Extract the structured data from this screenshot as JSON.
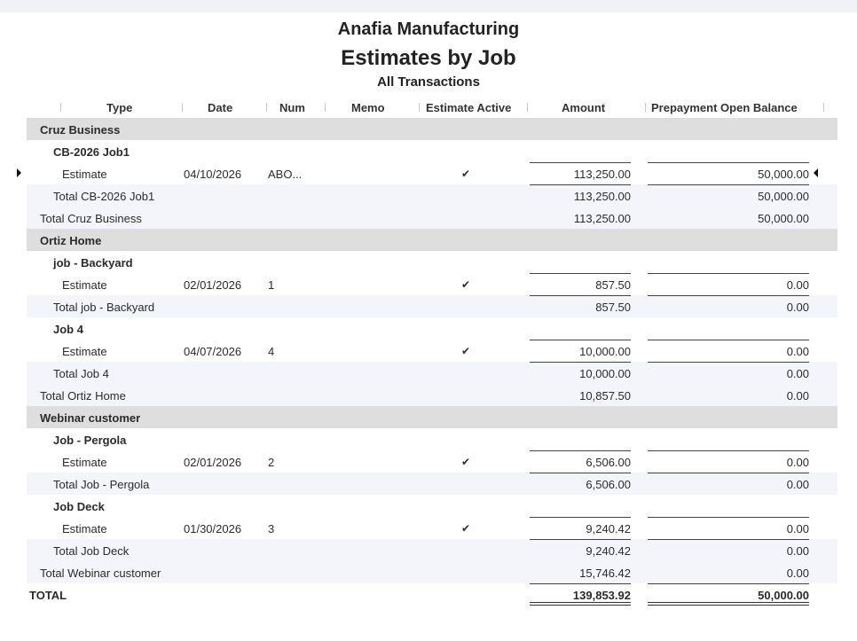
{
  "report": {
    "company": "Anafia Manufacturing",
    "name": "Estimates by Job",
    "period": "All Transactions"
  },
  "columns": {
    "type": "Type",
    "date": "Date",
    "num": "Num",
    "memo": "Memo",
    "active": "Estimate Active",
    "amount": "Amount",
    "prepay": "Prepayment Open Balance"
  },
  "rows": [
    {
      "kind": "customer",
      "label": "Cruz Business"
    },
    {
      "kind": "job",
      "label": "CB-2026 Job1"
    },
    {
      "kind": "txn",
      "label": "Estimate",
      "date": "04/10/2026",
      "num": "ABO...",
      "memo": "",
      "active": "✔",
      "amount": "113,250.00",
      "prepay": "50,000.00",
      "selected": true
    },
    {
      "kind": "jobtotal",
      "label": "Total CB-2026 Job1",
      "amount": "113,250.00",
      "prepay": "50,000.00"
    },
    {
      "kind": "custtotal",
      "label": "Total Cruz Business",
      "amount": "113,250.00",
      "prepay": "50,000.00"
    },
    {
      "kind": "customer",
      "label": "Ortiz Home"
    },
    {
      "kind": "job",
      "label": "job - Backyard"
    },
    {
      "kind": "txn",
      "label": "Estimate",
      "date": "02/01/2026",
      "num": "1",
      "memo": "",
      "active": "✔",
      "amount": "857.50",
      "prepay": "0.00"
    },
    {
      "kind": "jobtotal",
      "label": "Total job - Backyard",
      "amount": "857.50",
      "prepay": "0.00"
    },
    {
      "kind": "job",
      "label": "Job 4"
    },
    {
      "kind": "txn",
      "label": "Estimate",
      "date": "04/07/2026",
      "num": "4",
      "memo": "",
      "active": "✔",
      "amount": "10,000.00",
      "prepay": "0.00"
    },
    {
      "kind": "jobtotal",
      "label": "Total Job 4",
      "amount": "10,000.00",
      "prepay": "0.00"
    },
    {
      "kind": "custtotal",
      "label": "Total Ortiz Home",
      "amount": "10,857.50",
      "prepay": "0.00"
    },
    {
      "kind": "customer",
      "label": "Webinar customer"
    },
    {
      "kind": "job",
      "label": "Job - Pergola"
    },
    {
      "kind": "txn",
      "label": "Estimate",
      "date": "02/01/2026",
      "num": "2",
      "memo": "",
      "active": "✔",
      "amount": "6,506.00",
      "prepay": "0.00"
    },
    {
      "kind": "jobtotal",
      "label": "Total Job - Pergola",
      "amount": "6,506.00",
      "prepay": "0.00"
    },
    {
      "kind": "job",
      "label": "Job Deck"
    },
    {
      "kind": "txn",
      "label": "Estimate",
      "date": "01/30/2026",
      "num": "3",
      "memo": "",
      "active": "✔",
      "amount": "9,240.42",
      "prepay": "0.00"
    },
    {
      "kind": "jobtotal",
      "label": "Total Job Deck",
      "amount": "9,240.42",
      "prepay": "0.00"
    },
    {
      "kind": "custtotal",
      "label": "Total Webinar customer",
      "amount": "15,746.42",
      "prepay": "0.00"
    },
    {
      "kind": "grandtotal",
      "label": "TOTAL",
      "amount": "139,853.92",
      "prepay": "50,000.00"
    }
  ]
}
